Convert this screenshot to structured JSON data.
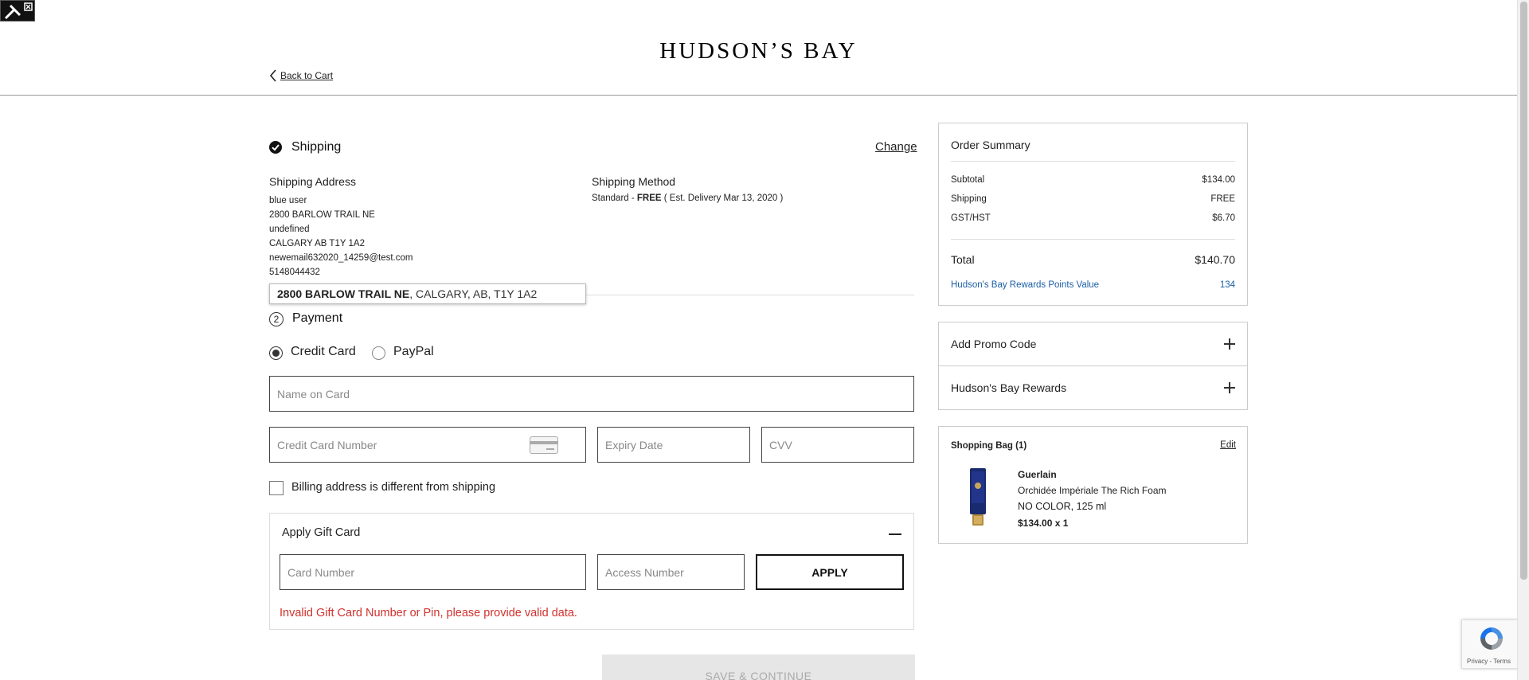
{
  "brand": {
    "logo_text": "HUDSON’S BAY"
  },
  "nav": {
    "back_label": "Back to Cart"
  },
  "shipping": {
    "title": "Shipping",
    "change_label": "Change",
    "address_label": "Shipping Address",
    "address_lines": [
      "blue user",
      "2800 BARLOW TRAIL NE",
      "undefined",
      "CALGARY AB T1Y 1A2",
      "newemail632020_14259@test.com",
      "5148044432"
    ],
    "method_label": "Shipping Method",
    "method_prefix": "Standard - ",
    "method_free": "FREE",
    "method_suffix": " ( Est. Delivery Mar 13, 2020 )"
  },
  "autocomplete": {
    "match_text": "2800 BARLOW TRAIL NE",
    "rest_text": ", CALGARY, AB, T1Y 1A2"
  },
  "payment": {
    "step_number": "2",
    "title": "Payment",
    "options": [
      {
        "label": "Credit Card",
        "selected": true
      },
      {
        "label": "PayPal",
        "selected": false
      }
    ],
    "name_placeholder": "Name on Card",
    "card_number_placeholder": "Credit Card Number",
    "expiry_placeholder": "Expiry Date",
    "cvv_placeholder": "CVV",
    "billing_checkbox_label": "Billing address is different from shipping",
    "billing_checked": false
  },
  "gift_card": {
    "title": "Apply Gift Card",
    "card_number_placeholder": "Card Number",
    "access_number_placeholder": "Access Number",
    "apply_label": "APPLY",
    "error_text": "Invalid Gift Card Number or Pin, please provide valid data."
  },
  "save_label": "SAVE & CONTINUE",
  "order_summary": {
    "title": "Order Summary",
    "rows": [
      {
        "label": "Subtotal",
        "value": "$134.00"
      },
      {
        "label": "Shipping",
        "value": "FREE"
      },
      {
        "label": "GST/HST",
        "value": "$6.70"
      }
    ],
    "total_label": "Total",
    "total_value": "$140.70",
    "rewards_label": "Hudson's Bay Rewards Points Value",
    "rewards_value": "134"
  },
  "accordions": {
    "promo_label": "Add Promo Code",
    "rewards_label": "Hudson's Bay Rewards"
  },
  "shopping_bag": {
    "title": "Shopping Bag (1)",
    "edit_label": "Edit",
    "item": {
      "brand": "Guerlain",
      "name": "Orchidée Impériale The Rich Foam",
      "variant": "NO COLOR, 125 ml",
      "price_qty": "$134.00 x 1"
    }
  },
  "recaptcha": {
    "footer": "Privacy - Terms"
  },
  "colors": {
    "error": "#d0312d",
    "rewards_link": "#1b5fa6"
  }
}
